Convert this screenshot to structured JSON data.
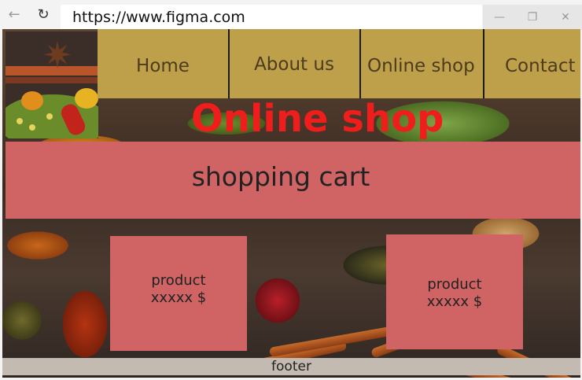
{
  "browser": {
    "url": "https://www.figma.com",
    "back_icon": "←",
    "reload_icon": "↻",
    "minimize_icon": "—",
    "maximize_icon": "❐",
    "close_icon": "✕"
  },
  "page": {
    "nav": {
      "items": [
        {
          "label": "Home"
        },
        {
          "label": "About us"
        },
        {
          "label": "Online shop"
        },
        {
          "label": "Contact"
        }
      ]
    },
    "hero_title": "Online shop",
    "cart_title": "shopping cart",
    "products": [
      {
        "name": "product",
        "price": "xxxxx $"
      },
      {
        "name": "product",
        "price": "xxxxx $"
      }
    ],
    "footer": "footer"
  },
  "colors": {
    "nav_bg": "#bfa04a",
    "card_bg": "#d06364",
    "hero_title": "#f01d1d",
    "footer_bg": "#c3bbb2"
  },
  "icons": {
    "logo": "spice-logo-icon"
  }
}
